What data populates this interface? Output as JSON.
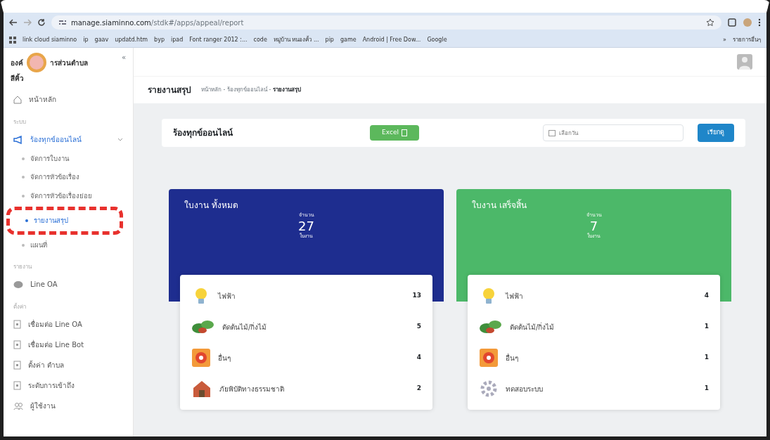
{
  "browser": {
    "url_host": "manage.siaminno.com",
    "url_path": "/stdk#/apps/appeal/report",
    "bookmarks": [
      "link cloud siaminno",
      "ip",
      "gaav",
      "updatd.htm",
      "byp",
      "ipad",
      "Font ranger 2012 :...",
      "code",
      "หมู่บ้าน หนองคั้ว ...",
      "pip",
      "game",
      "Android | Free Dow...",
      "Google"
    ],
    "more": "»",
    "other_bookmarks": "รายการอื่นๆ"
  },
  "sidebar": {
    "brand": [
      "องค์",
      "ารส่วนตำบล",
      "สีคิ้ว"
    ],
    "collapse": "«",
    "home": "หน้าหลัก",
    "sections": [
      {
        "title": "ระบบ",
        "items": [
          {
            "label": "ร้องทุกข์ออนไลน์",
            "kind": "megaphone",
            "expanded": true,
            "children": [
              {
                "label": "จัดการใบงาน",
                "selected": false
              },
              {
                "label": "จัดการหัวข้อเรื่อง",
                "selected": false
              },
              {
                "label": "จัดการหัวข้อเรื่องย่อย",
                "selected": false
              },
              {
                "label": "รายงานสรุป",
                "selected": true,
                "highlighted": true
              },
              {
                "label": "แผนที่",
                "selected": false
              }
            ]
          }
        ]
      },
      {
        "title": "รายงาน",
        "items": [
          {
            "label": "Line OA",
            "kind": "chat"
          }
        ]
      },
      {
        "title": "ตั้งค่า",
        "items": [
          {
            "label": "เชื่อมต่อ Line OA",
            "kind": "doc"
          },
          {
            "label": "เชื่อมต่อ Line Bot",
            "kind": "doc"
          },
          {
            "label": "ตั้งค่า ตำบล",
            "kind": "doc"
          },
          {
            "label": "ระดับการเข้าถึง",
            "kind": "doc"
          },
          {
            "label": "ผู้ใช้งาน",
            "kind": "users"
          }
        ]
      }
    ]
  },
  "page": {
    "title": "รายงานสรุป",
    "breadcrumb": [
      "หน้าหลัก",
      "ร้องทุกข์ออนไลน์",
      "รายงานสรุป"
    ],
    "separator": "-"
  },
  "filter": {
    "title": "ร้องทุกข์ออนไลน์",
    "excel": "Excel",
    "date_placeholder": "เลือกวัน",
    "submit": "เรียกดู"
  },
  "stats": [
    {
      "title": "ใบงาน ทั้งหมด",
      "color": "#1e2d8f",
      "label": "จำนวน",
      "count": "27",
      "unit": "ใบงาน",
      "rows": [
        {
          "kind": "bulb",
          "label": "ไฟฟ้า",
          "count": "13"
        },
        {
          "kind": "leaves",
          "label": "ตัดต้นไม้/กิ่งไม้",
          "count": "5"
        },
        {
          "kind": "box",
          "label": "อื่นๆ",
          "count": "4"
        },
        {
          "kind": "house",
          "label": "ภัยพิบัติทางธรรมชาติ",
          "count": "2"
        }
      ]
    },
    {
      "title": "ใบงาน เสร็จสิ้น",
      "color": "#4cb869",
      "label": "จำนวน",
      "count": "7",
      "unit": "ใบงาน",
      "rows": [
        {
          "kind": "bulb",
          "label": "ไฟฟ้า",
          "count": "4"
        },
        {
          "kind": "leaves",
          "label": "ตัดต้นไม้/กิ่งไม้",
          "count": "1"
        },
        {
          "kind": "box",
          "label": "อื่นๆ",
          "count": "1"
        },
        {
          "kind": "gear",
          "label": "ทดสอบระบบ",
          "count": "1"
        }
      ]
    }
  ]
}
